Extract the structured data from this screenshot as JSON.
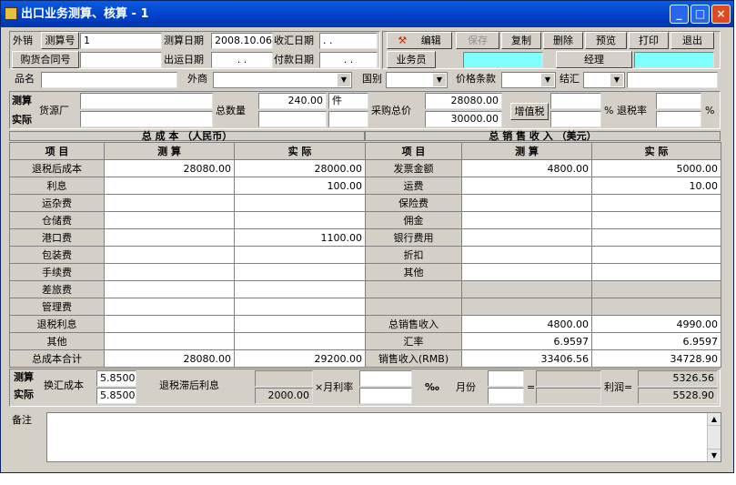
{
  "window": {
    "title": "出口业务测算、核算 - 1",
    "min": "_",
    "max": "□",
    "close": "×"
  },
  "header": {
    "waixiao": "外销",
    "cesuanhao_btn": "测算号",
    "cesuanhao_val": "1",
    "cesuan_date_label": "测算日期",
    "cesuan_date_val": "2008.10.06",
    "shouhui_date_label": "收汇日期",
    "shouhui_date_val": "  .  .",
    "gouhuo_btn": "购货合同号",
    "chuyun_label": "出运日期",
    "chuyun_val": "  .  .",
    "fukuan_label": "付款日期",
    "fukuan_val": "  .  .",
    "pinming": "品名",
    "waishang": "外商",
    "guobie": "国别",
    "jiage": "价格条款",
    "jiehui": "结汇"
  },
  "toolbar": {
    "edit": "编辑",
    "save": "保存",
    "copy": "复制",
    "delete": "删除",
    "preview": "预览",
    "print": "打印",
    "exit": "退出",
    "salesman": "业务员",
    "manager": "经理"
  },
  "summary": {
    "cesuan": "测算",
    "shiji": "实际",
    "gongyuan": "货源厂",
    "zongshuliang": "总数量",
    "qty": "240.00",
    "unit": "件",
    "caigou": "采购总价",
    "caigou_ce": "28080.00",
    "caigou_shi": "30000.00",
    "zengzhishui": "增值税",
    "tuishuilv": "% 退税率",
    "pct": "%"
  },
  "cost": {
    "title": "总  成  本  （人民币）",
    "col_item": "项  目",
    "col_ce": "测  算",
    "col_shi": "实  际",
    "rows": [
      {
        "name": "退税后成本",
        "ce": "28080.00",
        "shi": "28000.00"
      },
      {
        "name": "利息",
        "ce": "",
        "shi": "100.00"
      },
      {
        "name": "运杂费",
        "ce": "",
        "shi": ""
      },
      {
        "name": "仓储费",
        "ce": "",
        "shi": ""
      },
      {
        "name": "港口费",
        "ce": "",
        "shi": "1100.00"
      },
      {
        "name": "包装费",
        "ce": "",
        "shi": ""
      },
      {
        "name": "手续费",
        "ce": "",
        "shi": ""
      },
      {
        "name": "差旅费",
        "ce": "",
        "shi": ""
      },
      {
        "name": "管理费",
        "ce": "",
        "shi": ""
      },
      {
        "name": "退税利息",
        "ce": "",
        "shi": ""
      },
      {
        "name": "其他",
        "ce": "",
        "shi": ""
      },
      {
        "name": "总成本合计",
        "ce": "28080.00",
        "shi": "29200.00"
      }
    ]
  },
  "sales": {
    "title": "总  销  售  收  入  （美元）",
    "col_item": "项  目",
    "col_ce": "测  算",
    "col_shi": "实  际",
    "rows": [
      {
        "name": "发票金额",
        "ce": "4800.00",
        "shi": "5000.00"
      },
      {
        "name": "运费",
        "ce": "",
        "shi": "10.00"
      },
      {
        "name": "保险费",
        "ce": "",
        "shi": ""
      },
      {
        "name": "佣金",
        "ce": "",
        "shi": ""
      },
      {
        "name": "银行费用",
        "ce": "",
        "shi": ""
      },
      {
        "name": "折扣",
        "ce": "",
        "shi": ""
      },
      {
        "name": "其他",
        "ce": "",
        "shi": ""
      },
      {
        "name": "",
        "ce": "",
        "shi": ""
      },
      {
        "name": "",
        "ce": "",
        "shi": ""
      },
      {
        "name": "总销售收入",
        "ce": "4800.00",
        "shi": "4990.00"
      },
      {
        "name": "汇率",
        "ce": "6.9597",
        "shi": "6.9597"
      },
      {
        "name": "销售收入(RMB)",
        "ce": "33406.56",
        "shi": "34728.90"
      }
    ]
  },
  "bottom": {
    "cesuan": "测算",
    "shiji": "实际",
    "huanhui": "换汇成本",
    "hh_ce": "5.8500",
    "hh_shi": "5.8500",
    "tuishui_lixi": "退税滞后利息",
    "lixi_shi": "2000.00",
    "yuelilv": "×月利率",
    "permil": "‰",
    "yuefen": "月份",
    "eq": "=",
    "lirun": "利润=",
    "lirun_ce": "5326.56",
    "lirun_shi": "5528.90"
  },
  "remark": {
    "label": "备注"
  }
}
